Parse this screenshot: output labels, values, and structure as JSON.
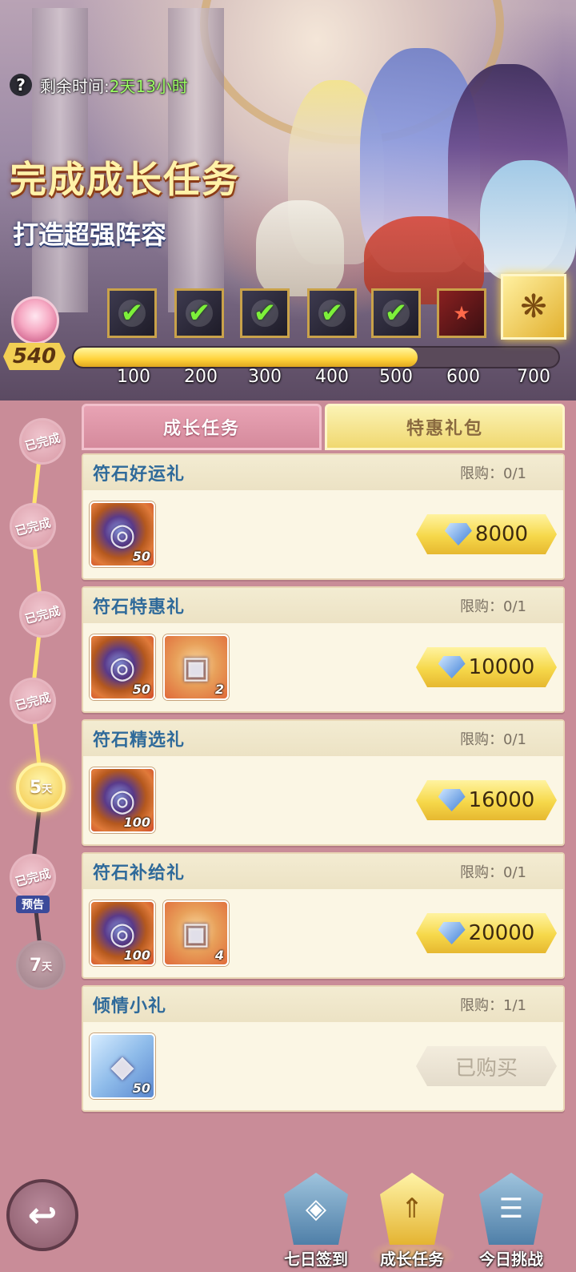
{
  "banner": {
    "timer_label": "剩余时间:",
    "timer_value": "2天13小时",
    "headline": "完成成长任务",
    "subline": "打造超强阵容"
  },
  "progress": {
    "points": "540",
    "fraction": 0.71,
    "milestones": [
      {
        "label": "100",
        "claimed": true,
        "icon": "hero-shard-icon"
      },
      {
        "label": "200",
        "claimed": true,
        "icon": "weapon-icon"
      },
      {
        "label": "300",
        "claimed": true,
        "icon": "rune-icon"
      },
      {
        "label": "400",
        "claimed": true,
        "icon": "hero-all-icon"
      },
      {
        "label": "500",
        "claimed": true,
        "icon": "sword-icon"
      },
      {
        "label": "600",
        "claimed": false,
        "icon": "hero-all-red-icon"
      },
      {
        "label": "700",
        "claimed": false,
        "icon": "card-reward-icon"
      }
    ]
  },
  "rail": {
    "days": [
      {
        "label": "已完成",
        "state": "done"
      },
      {
        "label": "已完成",
        "state": "done"
      },
      {
        "label": "已完成",
        "state": "done"
      },
      {
        "label": "已完成",
        "state": "done"
      },
      {
        "label": "5",
        "suffix": "天",
        "state": "active"
      },
      {
        "label": "已完成",
        "state": "done"
      },
      {
        "label": "7",
        "suffix": "天",
        "state": "locked"
      }
    ],
    "preview_tag": "预告"
  },
  "tabs": {
    "growth": "成长任务",
    "special": "特惠礼包"
  },
  "packs": [
    {
      "title": "符石好运礼",
      "limit": "限购：0/1",
      "price": "8000",
      "items": [
        {
          "type": "rune",
          "qty": "50"
        }
      ]
    },
    {
      "title": "符石特惠礼",
      "limit": "限购：0/1",
      "price": "10000",
      "items": [
        {
          "type": "rune",
          "qty": "50"
        },
        {
          "type": "chest",
          "qty": "2"
        }
      ]
    },
    {
      "title": "符石精选礼",
      "limit": "限购：0/1",
      "price": "16000",
      "items": [
        {
          "type": "rune",
          "qty": "100"
        }
      ]
    },
    {
      "title": "符石补给礼",
      "limit": "限购：0/1",
      "price": "20000",
      "items": [
        {
          "type": "rune",
          "qty": "100"
        },
        {
          "type": "chest",
          "qty": "4"
        }
      ]
    },
    {
      "title": "倾情小礼",
      "limit": "限购：1/1",
      "price": "已购买",
      "items": [
        {
          "type": "gem",
          "qty": "50"
        }
      ]
    }
  ],
  "nav": {
    "checkin": "七日签到",
    "growth": "成长任务",
    "challenge": "今日挑战"
  },
  "colors": {
    "accent_gold": "#f6d84a",
    "title_blue": "#2f6a9a",
    "timer_green": "#9cff64",
    "page_pink": "#c98c98"
  }
}
